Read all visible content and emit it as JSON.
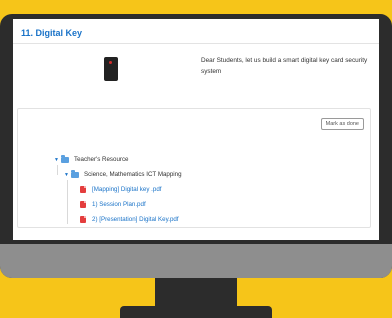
{
  "section": {
    "title": "11. Digital Key",
    "description": "Dear Students, let us build a smart digital key card security system"
  },
  "activity": {
    "mark_done_label": "Mark as done"
  },
  "tree": {
    "root": {
      "label": "Teacher's Resource",
      "icon": "folder-icon"
    },
    "child": {
      "label": "Science, Mathematics ICT Mapping",
      "icon": "folder-icon"
    },
    "files": [
      {
        "label": "[Mapping] Digital key .pdf",
        "icon": "pdf-icon"
      },
      {
        "label": "1) Session Plan.pdf",
        "icon": "pdf-icon"
      },
      {
        "label": "2) [Presentation] Digital Key.pdf",
        "icon": "pdf-icon"
      }
    ]
  },
  "colors": {
    "background": "#f6c519",
    "link": "#1a73c8",
    "pdf": "#e43d3d"
  }
}
